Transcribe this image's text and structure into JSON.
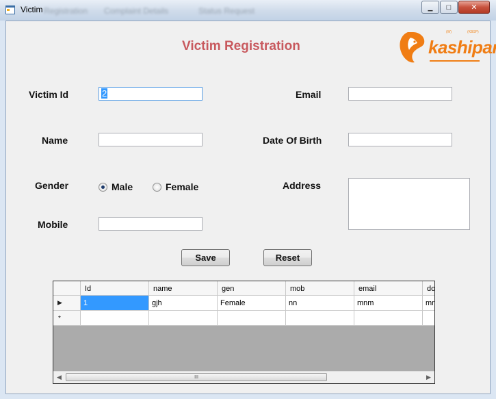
{
  "window": {
    "title": "Victim",
    "ghost_menu": [
      "Registration",
      "Complaint Details",
      "Status Request"
    ],
    "min_glyph": "▁",
    "max_glyph": "□",
    "close_glyph": "✕"
  },
  "form": {
    "title": "Victim Registration",
    "victim_id_label": "Victim Id",
    "victim_id_value": "2",
    "name_label": "Name",
    "gender_label": "Gender",
    "gender_options": [
      "Male",
      "Female"
    ],
    "gender_selected": "Male",
    "mobile_label": "Mobile",
    "email_label": "Email",
    "dob_label": "Date Of Birth",
    "address_label": "Address",
    "save_label": "Save",
    "reset_label": "Reset"
  },
  "logo": {
    "text": "kashipara",
    "tag_left": "(W)",
    "tag_right": "(KBSP)"
  },
  "grid": {
    "columns": [
      "Id",
      "name",
      "gen",
      "mob",
      "email",
      "do"
    ],
    "rows": [
      [
        "1",
        "gjh",
        "Female",
        "nn",
        "mnm",
        "mn"
      ]
    ],
    "row_markers": [
      "▶",
      "*"
    ],
    "scroll_thumb_glyph": "III",
    "scroll_left_glyph": "◀",
    "scroll_right_glyph": "▶"
  },
  "colors": {
    "title": "#c8595e",
    "logo": "#f07d14",
    "selection": "#3399ff"
  }
}
